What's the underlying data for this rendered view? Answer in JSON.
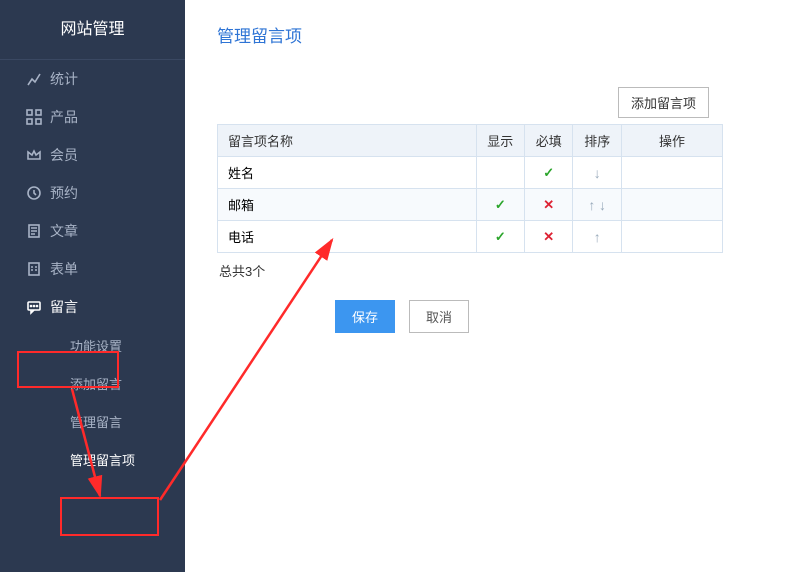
{
  "sidebar": {
    "title": "网站管理",
    "items": [
      {
        "label": "统计",
        "icon": "chart-icon"
      },
      {
        "label": "产品",
        "icon": "grid-icon"
      },
      {
        "label": "会员",
        "icon": "crown-icon"
      },
      {
        "label": "预约",
        "icon": "clock-icon"
      },
      {
        "label": "文章",
        "icon": "doc-icon"
      },
      {
        "label": "表单",
        "icon": "form-icon"
      },
      {
        "label": "留言",
        "icon": "message-icon",
        "active": true,
        "children": [
          {
            "label": "功能设置"
          },
          {
            "label": "添加留言"
          },
          {
            "label": "管理留言"
          },
          {
            "label": "管理留言项",
            "active": true
          }
        ]
      }
    ]
  },
  "main": {
    "title": "管理留言项",
    "add_button": "添加留言项",
    "table": {
      "headers": {
        "name": "留言项名称",
        "show": "显示",
        "req": "必填",
        "sort": "排序",
        "op": "操作"
      },
      "rows": [
        {
          "name": "姓名",
          "show": true,
          "req": "check",
          "sort_up": false,
          "sort_down": true
        },
        {
          "name": "邮箱",
          "show": "check",
          "req": "cross",
          "sort_up": true,
          "sort_down": true
        },
        {
          "name": "电话",
          "show": "check",
          "req": "cross",
          "sort_up": true,
          "sort_down": false
        }
      ]
    },
    "summary": "总共3个",
    "save_label": "保存",
    "cancel_label": "取消"
  }
}
